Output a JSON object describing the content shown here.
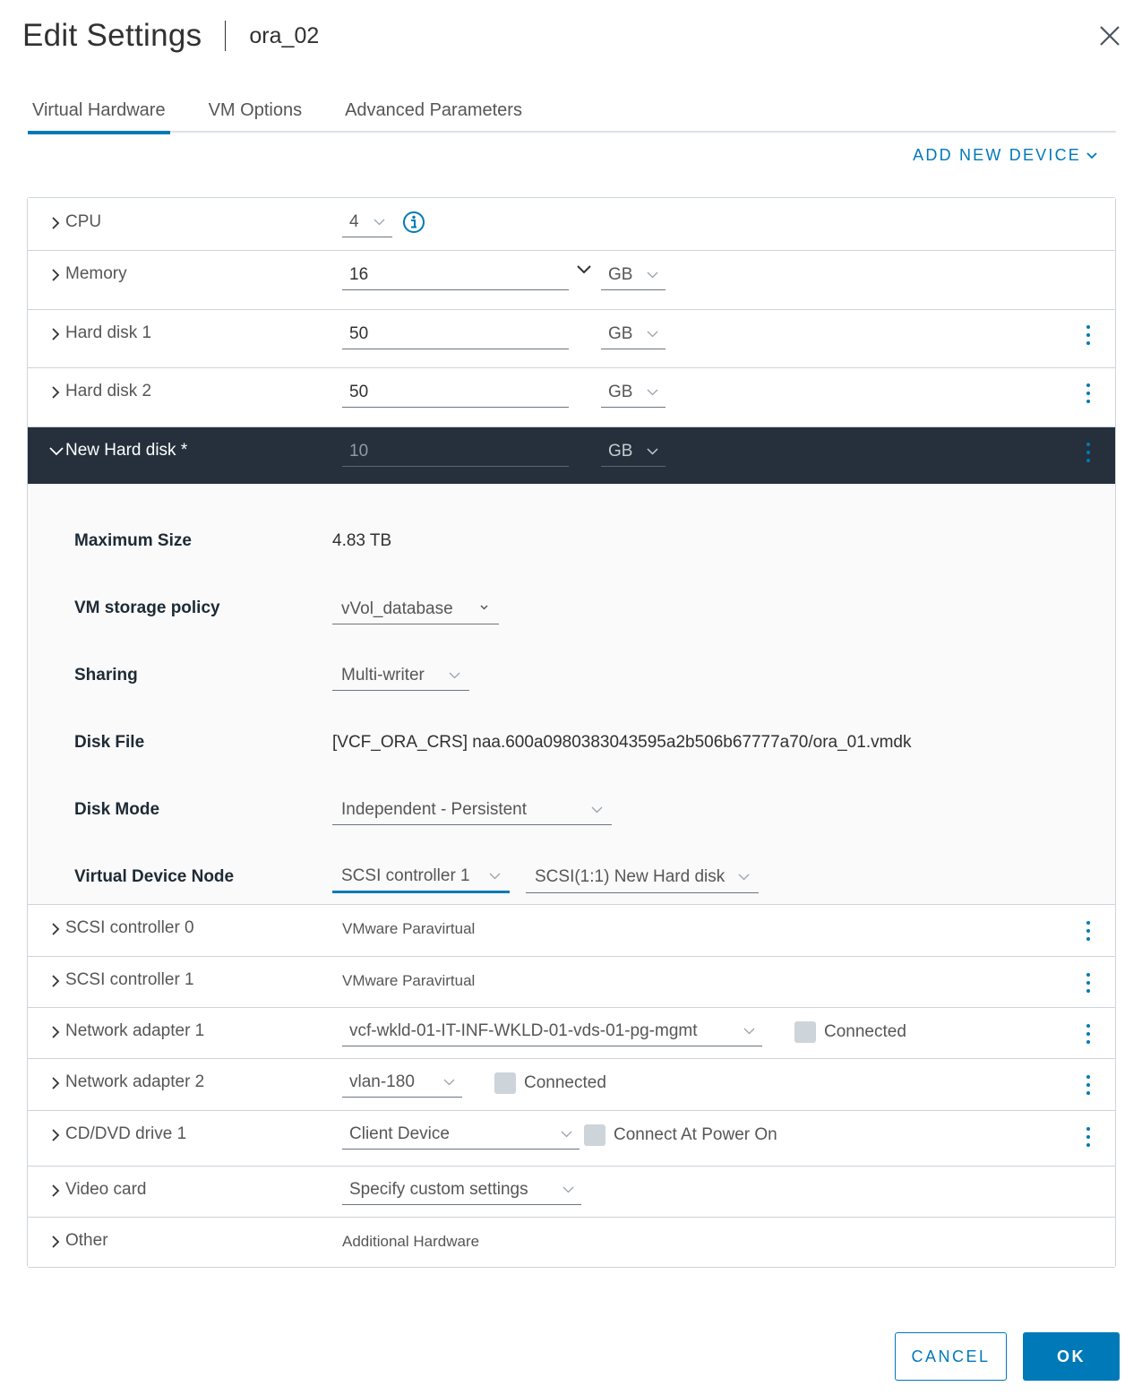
{
  "header": {
    "title": "Edit Settings",
    "vm_name": "ora_02"
  },
  "tabs": [
    {
      "label": "Virtual Hardware",
      "active": true
    },
    {
      "label": "VM Options",
      "active": false
    },
    {
      "label": "Advanced Parameters",
      "active": false
    }
  ],
  "add_new_device": "ADD NEW DEVICE",
  "colors": {
    "accent": "#0079b8",
    "selected_row_bg": "#25303c",
    "border": "#cdd4da"
  },
  "hardware": {
    "cpu": {
      "label": "CPU",
      "value": "4"
    },
    "memory": {
      "label": "Memory",
      "value": "16",
      "unit": "GB"
    },
    "hard_disk_1": {
      "label": "Hard disk 1",
      "value": "50",
      "unit": "GB"
    },
    "hard_disk_2": {
      "label": "Hard disk 2",
      "value": "50",
      "unit": "GB"
    },
    "new_hard_disk": {
      "label": "New Hard disk *",
      "value": "10",
      "unit": "GB",
      "details": {
        "max_size_label": "Maximum Size",
        "max_size_value": "4.83 TB",
        "storage_policy_label": "VM storage policy",
        "storage_policy_value": "vVol_database",
        "sharing_label": "Sharing",
        "sharing_value": "Multi-writer",
        "disk_file_label": "Disk File",
        "disk_file_value": "[VCF_ORA_CRS] naa.600a0980383043595a2b506b67777a70/ora_01.vmdk",
        "disk_mode_label": "Disk Mode",
        "disk_mode_value": "Independent - Persistent",
        "vdn_label": "Virtual Device Node",
        "vdn_controller": "SCSI controller 1",
        "vdn_node": "SCSI(1:1) New Hard disk"
      }
    },
    "scsi_0": {
      "label": "SCSI controller 0",
      "value": "VMware Paravirtual"
    },
    "scsi_1": {
      "label": "SCSI controller 1",
      "value": "VMware Paravirtual"
    },
    "net_1": {
      "label": "Network adapter 1",
      "value": "vcf-wkld-01-IT-INF-WKLD-01-vds-01-pg-mgmt",
      "check_label": "Connected"
    },
    "net_2": {
      "label": "Network adapter 2",
      "value": "vlan-180",
      "check_label": "Connected"
    },
    "cd_dvd": {
      "label": "CD/DVD drive 1",
      "value": "Client Device",
      "check_label": "Connect At Power On"
    },
    "video": {
      "label": "Video card",
      "value": "Specify custom settings"
    },
    "other": {
      "label": "Other",
      "value": "Additional Hardware"
    }
  },
  "footer": {
    "cancel": "CANCEL",
    "ok": "OK"
  }
}
